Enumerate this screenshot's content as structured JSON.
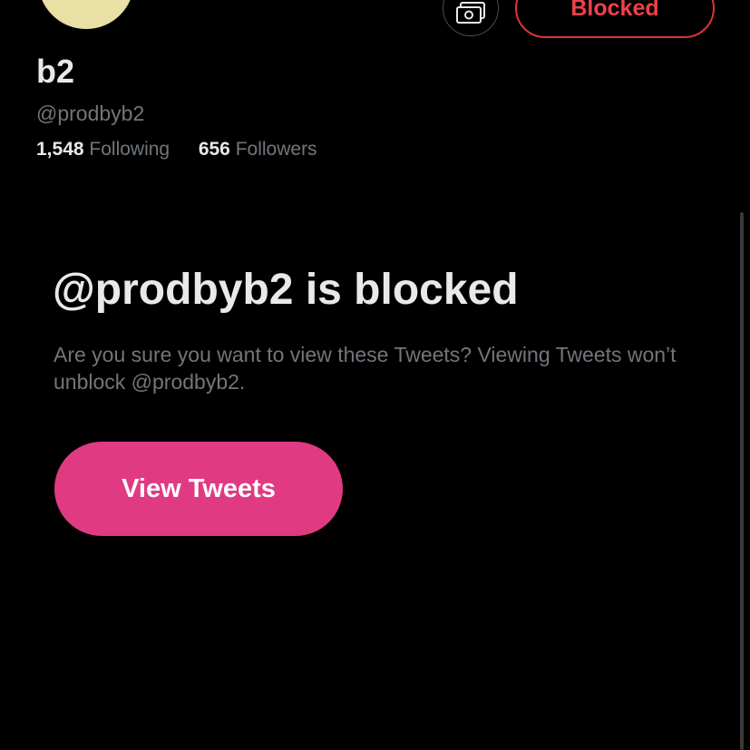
{
  "profile": {
    "display_name": "b2",
    "handle": "@prodbyb2",
    "following_count": "1,548",
    "following_label": "Following",
    "followers_count": "656",
    "followers_label": "Followers"
  },
  "actions": {
    "tip_icon": "money-icon",
    "blocked_label": "Blocked"
  },
  "blocked_notice": {
    "title": "@prodbyb2 is blocked",
    "description": "Are you sure you want to view these Tweets? Viewing Tweets won’t unblock @prodbyb2.",
    "view_button_label": "View Tweets"
  },
  "colors": {
    "background": "#000000",
    "blocked_red": "#f04049",
    "accent_pink": "#e03a82",
    "secondary_text": "#71767b",
    "avatar": "#e8e0a4"
  }
}
